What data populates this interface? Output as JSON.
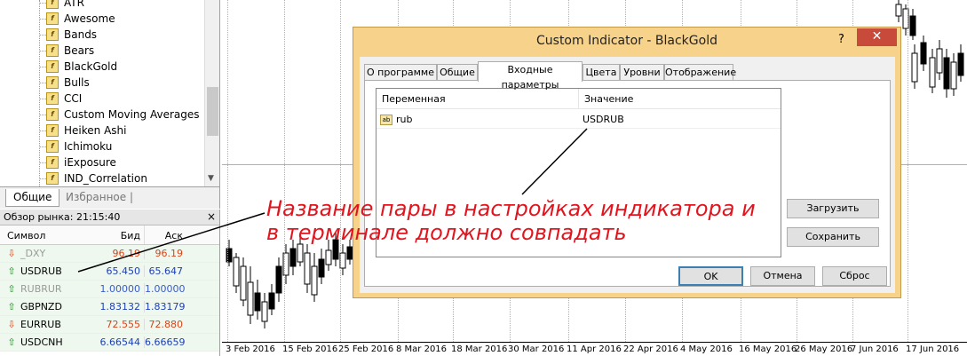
{
  "navigator": {
    "items": [
      "ATR",
      "Awesome",
      "Bands",
      "Bears",
      "BlackGold",
      "Bulls",
      "CCI",
      "Custom Moving Averages",
      "Heiken Ashi",
      "Ichimoku",
      "iExposure",
      "IND_Correlation"
    ],
    "tabs": [
      "Общие",
      "Избранное"
    ]
  },
  "market_watch": {
    "title": "Обзор рынка: 21:15:40",
    "columns": [
      "Символ",
      "Бид",
      "Аск"
    ],
    "rows": [
      {
        "symbol": "_DXY",
        "bid": "96.19",
        "ask": "96.19",
        "dir": "down",
        "dim": true
      },
      {
        "symbol": "USDRUB",
        "bid": "65.450",
        "ask": "65.647",
        "dir": "up",
        "dim": false
      },
      {
        "symbol": "RUBRUR",
        "bid": "1.00000",
        "ask": "1.00000",
        "dir": "up",
        "dim": true
      },
      {
        "symbol": "GBPNZD",
        "bid": "1.83132",
        "ask": "1.83179",
        "dir": "up",
        "dim": false
      },
      {
        "symbol": "EURRUB",
        "bid": "72.555",
        "ask": "72.880",
        "dir": "down",
        "dim": false
      },
      {
        "symbol": "USDCNH",
        "bid": "6.66544",
        "ask": "6.66659",
        "dir": "up",
        "dim": false
      }
    ]
  },
  "chart": {
    "dates": [
      "3 Feb 2016",
      "15 Feb 2016",
      "25 Feb 2016",
      "8 Mar 2016",
      "18 Mar 2016",
      "30 Mar 2016",
      "11 Apr 2016",
      "22 Apr 2016",
      "4 May 2016",
      "16 May 2016",
      "26 May 2016",
      "7 Jun 2016",
      "17 Jun 2016"
    ]
  },
  "dialog": {
    "title": "Custom Indicator - BlackGold",
    "help": "?",
    "close": "✕",
    "tabs": [
      "О программе",
      "Общие",
      "Входные параметры",
      "Цвета",
      "Уровни",
      "Отображение"
    ],
    "active_tab": "Входные параметры",
    "columns": [
      "Переменная",
      "Значение"
    ],
    "param": {
      "icon": "ab",
      "name": "rub",
      "value": "USDRUB"
    },
    "buttons": {
      "load": "Загрузить",
      "save": "Сохранить",
      "ok": "OK",
      "cancel": "Отмена",
      "reset": "Сброс"
    }
  },
  "annotation": "Название пары в настройках индикатора и в терминале должно совпадать",
  "colors": {
    "dialog_frame": "#f7d28a",
    "annotation": "#e2141e",
    "close": "#c74a3a"
  }
}
